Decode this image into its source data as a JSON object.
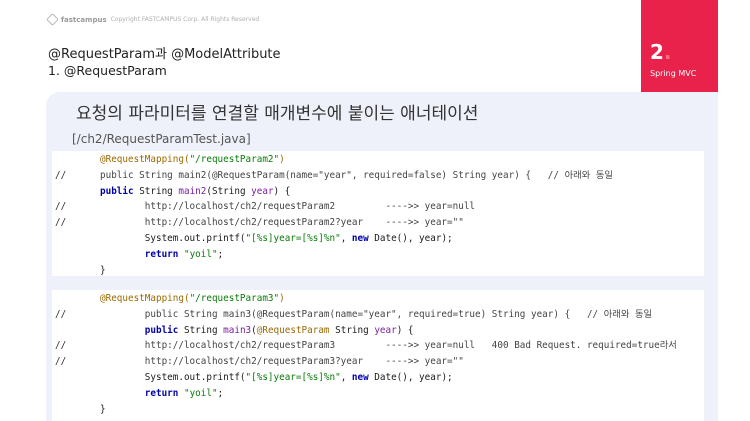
{
  "slide": {
    "logo_brand": "fastcampus",
    "logo_sub": "Copyright FASTCAMPUS Corp. All Rights Reserved",
    "section_number": "2",
    "section_dot": ".",
    "section_name": "Spring MVC",
    "heading1": "@RequestParam과 @ModelAttribute",
    "heading2": "1. @RequestParam",
    "band_title": "요청의 파라미터를 연결할 매개변수에 붙이는 애너테이션",
    "file_label": "[/ch2/RequestParamTest.java]"
  },
  "code1": {
    "l1_ann": "@RequestMapping(",
    "l1_str": "\"/requestParam2\"",
    "l1_end": ")",
    "l2_cm": "//",
    "l2": "public String main2(@RequestParam(name=\"year\", required=false) String year) {   // 아래와 동일",
    "l3_kw": "public",
    "l3_a": " String ",
    "l3_fn": "main2",
    "l3_b": "(String ",
    "l3_var": "year",
    "l3_c": ") {",
    "l4_cm": "//",
    "l4": "        http://localhost/ch2/requestParam2         ---->> year=null",
    "l5_cm": "//",
    "l5": "        http://localhost/ch2/requestParam2?year    ---->> year=\"\"",
    "l6_a": "        System.out.printf(",
    "l6_str": "\"[%s]year=[%s]%n\"",
    "l6_b": ", ",
    "l6_kw": "new",
    "l6_c": " Date(), year);",
    "l7_a": "        ",
    "l7_kw": "return",
    "l7_b": " ",
    "l7_str": "\"yoil\"",
    "l7_c": ";",
    "l8": "}"
  },
  "code2": {
    "l1_ann": "@RequestMapping(",
    "l1_str": "\"/requestParam3\"",
    "l1_end": ")",
    "l2_cm": "//",
    "l2": "        public String main3(@RequestParam(name=\"year\", required=true) String year) {   // 아래와 동일",
    "l3_a": "        ",
    "l3_kw": "public",
    "l3_b": " String ",
    "l3_fn": "main3",
    "l3_c": "(",
    "l3_ann": "@RequestParam",
    "l3_d": " String ",
    "l3_var": "year",
    "l3_e": ") {",
    "l4_cm": "//",
    "l4": "        http://localhost/ch2/requestParam3         ---->> year=null   400 Bad Request. required=true라서",
    "l5_cm": "//",
    "l5": "        http://localhost/ch2/requestParam3?year    ---->> year=\"\"",
    "l6_a": "        System.out.printf(",
    "l6_str": "\"[%s]year=[%s]%n\"",
    "l6_b": ", ",
    "l6_kw": "new",
    "l6_c": " Date(), year);",
    "l7_a": "        ",
    "l7_kw": "return",
    "l7_b": " ",
    "l7_str": "\"yoil\"",
    "l7_c": ";",
    "l8": "}"
  }
}
